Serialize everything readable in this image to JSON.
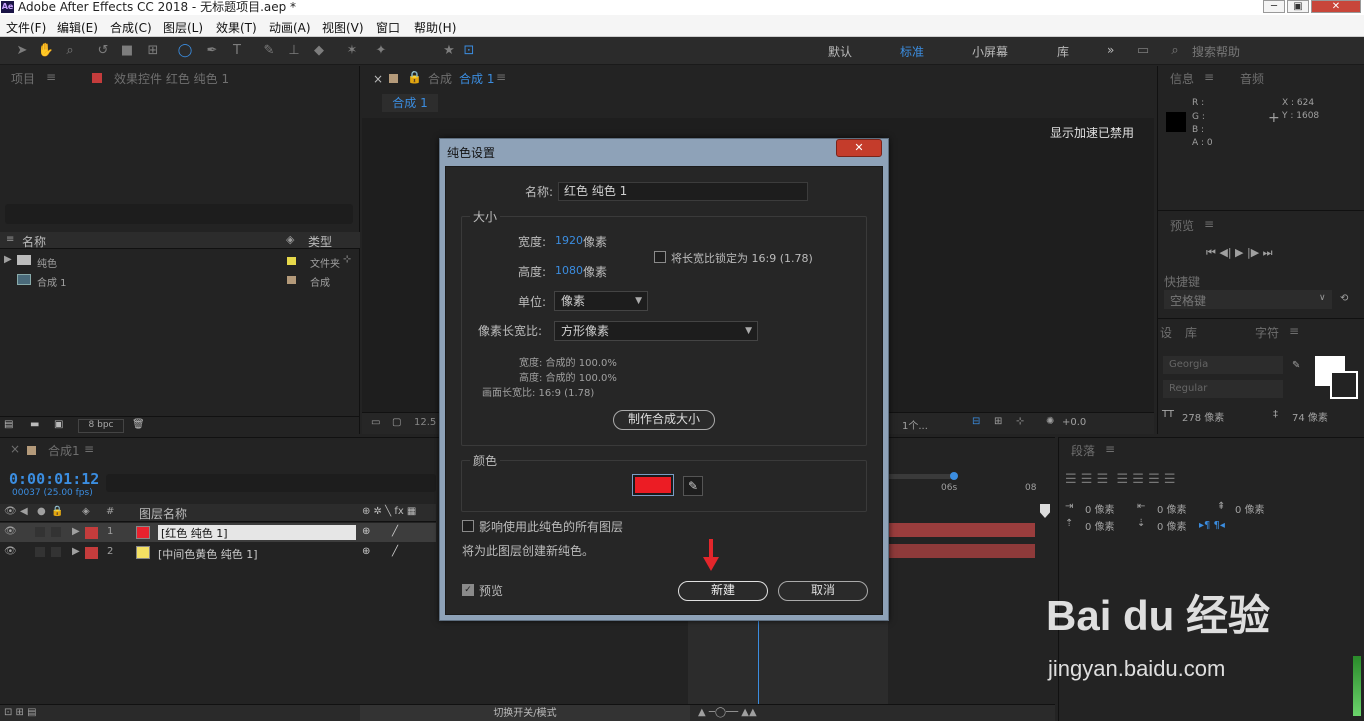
{
  "app": {
    "title": "Adobe After Effects CC 2018 - 无标题项目.aep *",
    "icon": "Ae"
  },
  "menu": [
    "文件(F)",
    "编辑(E)",
    "合成(C)",
    "图层(L)",
    "效果(T)",
    "动画(A)",
    "视图(V)",
    "窗口",
    "帮助(H)"
  ],
  "workspaces": {
    "default": "默认",
    "standard": "标准",
    "small": "小屏幕",
    "library": "库",
    "more": "»",
    "search_placeholder": "搜索帮助"
  },
  "project_panel": {
    "tab": "项目",
    "effects_tab": "效果控件 红色 纯色 1",
    "col_name": "名称",
    "col_type": "类型",
    "items": [
      {
        "name": "纯色",
        "type": "文件夹"
      },
      {
        "name": "合成 1",
        "type": "合成"
      }
    ],
    "bpc": "8 bpc"
  },
  "comp_panel": {
    "tab_prefix": "合成",
    "tab": "合成 1",
    "subtab": "合成 1",
    "accel_msg": "显示加速已禁用",
    "bottom_left": "12.5",
    "bottom_count": "1个...",
    "bottom_val": "+0.0"
  },
  "info_panel": {
    "tab": "信息",
    "audio_tab": "音频",
    "r": "R :",
    "g": "G :",
    "b": "B :",
    "a": "A : 0",
    "x": "X : 624",
    "y": "Y : 1608",
    "preview_tab": "预览",
    "shortcut_label": "快捷键",
    "shortcut_value": "空格键",
    "char_tabs": [
      "设",
      "库",
      "字符"
    ],
    "font": "Georgia",
    "style": "Regular",
    "size": "278 像素",
    "leading": "74 像素",
    "para_tab": "段落",
    "para_vals": [
      "0 像素",
      "0 像素",
      "0 像素",
      "0 像素",
      "0 像素"
    ]
  },
  "timeline": {
    "tab": "合成1",
    "timecode": "0:00:01:12",
    "frames": "00037 (25.00 fps)",
    "col_num": "#",
    "col_layer": "图层名称",
    "layers": [
      {
        "num": "1",
        "name": "[红色 纯色 1]",
        "color": "#e8222e"
      },
      {
        "num": "2",
        "name": "[中间色黄色 纯色 1]",
        "color": "#f3e063"
      }
    ],
    "ruler": [
      "06s",
      "08"
    ],
    "switch_mode": "切换开关/模式"
  },
  "dialog": {
    "title": "纯色设置",
    "close": "✕",
    "name_label": "名称:",
    "name_value": "红色 纯色 1",
    "size_section": "大小",
    "width_label": "宽度:",
    "width_value": "1920",
    "width_unit": "像素",
    "height_label": "高度:",
    "height_value": "1080",
    "height_unit": "像素",
    "lock_ratio": "将长宽比锁定为 16:9 (1.78)",
    "unit_label": "单位:",
    "unit_value": "像素",
    "par_label": "像素长宽比:",
    "par_value": "方形像素",
    "info_width": "宽度: 合成的 100.0%",
    "info_height": "高度: 合成的 100.0%",
    "info_ratio": "画面长宽比: 16:9 (1.78)",
    "make_comp_size": "制作合成大小",
    "color_section": "颜色",
    "swatch_color": "#ec1c24",
    "affect_all": "影响使用此纯色的所有图层",
    "create_note": "将为此图层创建新纯色。",
    "preview": "预览",
    "new_button": "新建",
    "cancel_button": "取消"
  },
  "watermark": {
    "brand": "Bai du 经验",
    "url": "jingyan.baidu.com"
  }
}
